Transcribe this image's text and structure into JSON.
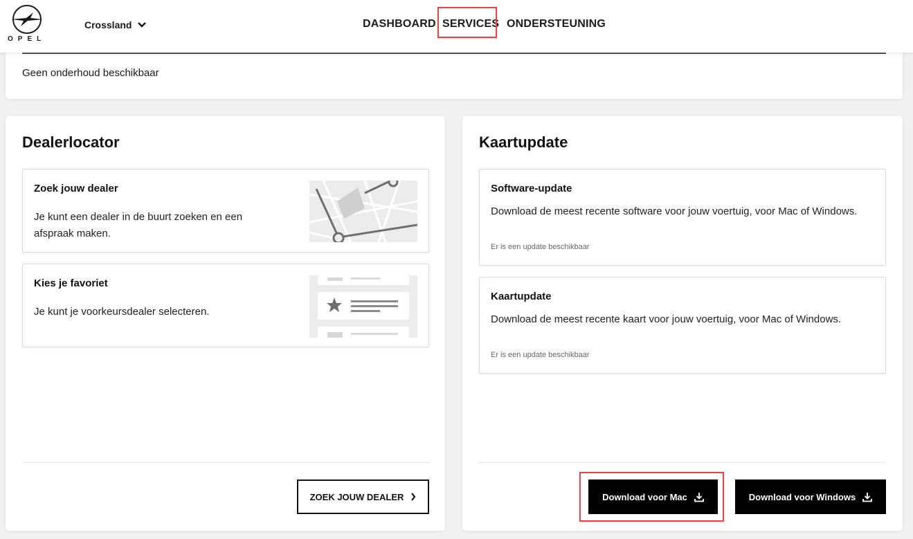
{
  "header": {
    "brand": "OPEL",
    "model": "Crossland",
    "nav": {
      "dashboard": "DASHBOARD",
      "services": "SERVICES",
      "support": "ONDERSTEUNING"
    }
  },
  "maintenance": {
    "message": "Geen onderhoud beschikbaar"
  },
  "dealerlocator": {
    "title": "Dealerlocator",
    "tiles": [
      {
        "title": "Zoek jouw dealer",
        "description": "Je kunt een dealer in de buurt zoeken en een afspraak maken.",
        "icon": "map-illustration-icon"
      },
      {
        "title": "Kies je favoriet",
        "description": "Je kunt je voorkeursdealer selecteren.",
        "icon": "favorite-list-illustration-icon"
      }
    ],
    "button_label": "ZOEK JOUW DEALER"
  },
  "kaartupdate": {
    "title": "Kaartupdate",
    "tiles": [
      {
        "title": "Software-update",
        "description": "Download de meest recente software voor jouw voertuig, voor Mac of Windows.",
        "status": "Er is een update beschikbaar"
      },
      {
        "title": "Kaartupdate",
        "description": "Download de meest recente kaart voor jouw voertuig, voor Mac of Windows.",
        "status": "Er is een update beschikbaar"
      }
    ],
    "download_mac_label": "Download voor Mac",
    "download_windows_label": "Download voor Windows"
  },
  "colors": {
    "highlight": "#e64545",
    "button_dark": "#000000",
    "background": "#f1f1f1"
  }
}
